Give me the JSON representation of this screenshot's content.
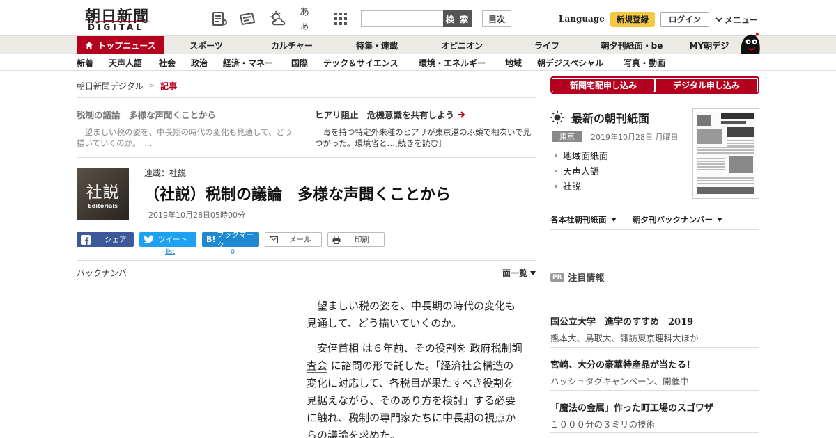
{
  "header": {
    "logo_main": "朝日新聞",
    "logo_sub": "DIGITAL",
    "search_button": "検 索",
    "toc_button": "目次",
    "language": "Language",
    "signup": "新規登録",
    "login": "ログイン",
    "menu": "メニュー",
    "font_size_icon_text": "あぁ"
  },
  "nav_main": [
    "トップニュース",
    "スポーツ",
    "カルチャー",
    "特集・連載",
    "オピニオン",
    "ライフ",
    "朝夕刊紙面・be",
    "MY朝デジ"
  ],
  "nav_sub": [
    "新着",
    "天声人語",
    "社会",
    "政治",
    "経済・マネー",
    "国際",
    "テック＆サイエンス",
    "環境・エネルギー",
    "地域",
    "朝デジスペシャル",
    "写真・動画"
  ],
  "breadcrumb": {
    "home": "朝日新聞デジタル",
    "sep": ">",
    "current": "記事"
  },
  "related": [
    {
      "title": "税制の議論　多様な声聞くことから",
      "desc": "望ましい税の姿を、中長期の時代の変化も見通して、どう描いていくのか。　…"
    },
    {
      "title": "ヒアリ阻止　危機意識を共有しよう",
      "desc": "毒を持つ特定外来種のヒアリが東京港のふ頭で相次いで見つかった。環境省と…[続きを読む]"
    }
  ],
  "article": {
    "image_kanji": "社説",
    "image_en": "Editorials",
    "series": "連載：社説",
    "title": "（社説）税制の議論　多様な声聞くことから",
    "date": "2019年10月28日05時00分",
    "share": {
      "facebook": "シェア",
      "twitter": "ツイート",
      "hatena": "ブックマーク",
      "hatena_icon": "B!",
      "mail": "メール",
      "print": "印刷",
      "twitter_count": "list",
      "hatena_count": "0"
    },
    "back_number": "バックナンバー",
    "listing": "面一覧",
    "p1": "望ましい税の姿を、中長期の時代の変化も見通して、どう描いていくのか。",
    "p2_a": "安倍首相",
    "p2_b": " は６年前、その役割を ",
    "p2_c": "政府税制調査会",
    "p2_d": " に諮問の形で託した。「経済社会構造の変化に対応して、各税目が果たすべき役割を見据えながら、そのあり方を検討」する必要に触れ、税制の専門家たちに中長期の視点からの議論を求めた。"
  },
  "sidebar": {
    "sub_buttons": [
      "新聞宅配申し込み",
      "デジタル申し込み"
    ],
    "paper_title": "最新の朝刊紙面",
    "region": "東京",
    "paper_date": "2019年10月28日 月曜日",
    "paper_links": [
      "地域面紙面",
      "天声人語",
      "社説"
    ],
    "dropdowns": [
      "各本社朝刊紙面",
      "朝夕刊バックナンバー"
    ],
    "pr_badge": "PR",
    "pr_label": "注目情報",
    "pr_items": [
      {
        "title": "国公立大学　進学のすすめ　2019",
        "sub": "熊本大、鳥取大、諏訪東京理科大ほか"
      },
      {
        "title": "宮崎、大分の豪華特産品が当たる！",
        "sub": "ハッシュタグキャンペーン、開催中"
      },
      {
        "title": "「魔法の金属」作った町工場のスゴワザ",
        "sub": "１０００分の３ミリの技術"
      }
    ]
  },
  "colors": {
    "brand_red": "#b4001e",
    "signup_yellow": "#f5c842",
    "facebook": "#3b5998",
    "twitter": "#1da1f2",
    "hatena": "#1e88d0"
  }
}
